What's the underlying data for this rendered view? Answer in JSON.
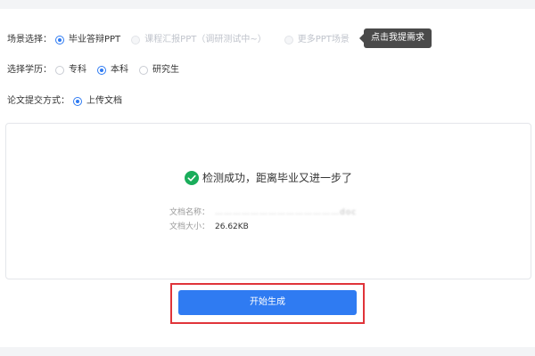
{
  "scene": {
    "label": "场景选择：",
    "options": [
      {
        "label": "毕业答辩PPT",
        "checked": true,
        "disabled": false
      },
      {
        "label": "课程汇报PPT（调研测试中~）",
        "checked": false,
        "disabled": true
      },
      {
        "label": "更多PPT场景",
        "checked": false,
        "disabled": true
      }
    ],
    "tooltip": "点击我提需求"
  },
  "degree": {
    "label": "选择学历：",
    "options": [
      {
        "label": "专科",
        "checked": false
      },
      {
        "label": "本科",
        "checked": true
      },
      {
        "label": "研究生",
        "checked": false
      }
    ]
  },
  "submit_method": {
    "label": "论文提交方式：",
    "options": [
      {
        "label": "上传文档",
        "checked": true
      }
    ]
  },
  "upload": {
    "success_text": "检测成功，距离毕业又进一步了",
    "name_label": "文档名称：",
    "name_value": "……………………………………doc",
    "size_label": "文档大小：",
    "size_value": "26.62KB"
  },
  "action": {
    "generate_label": "开始生成"
  },
  "colors": {
    "accent": "#2f7bf2",
    "success": "#1aad5b",
    "highlight_border": "#e0343a"
  }
}
